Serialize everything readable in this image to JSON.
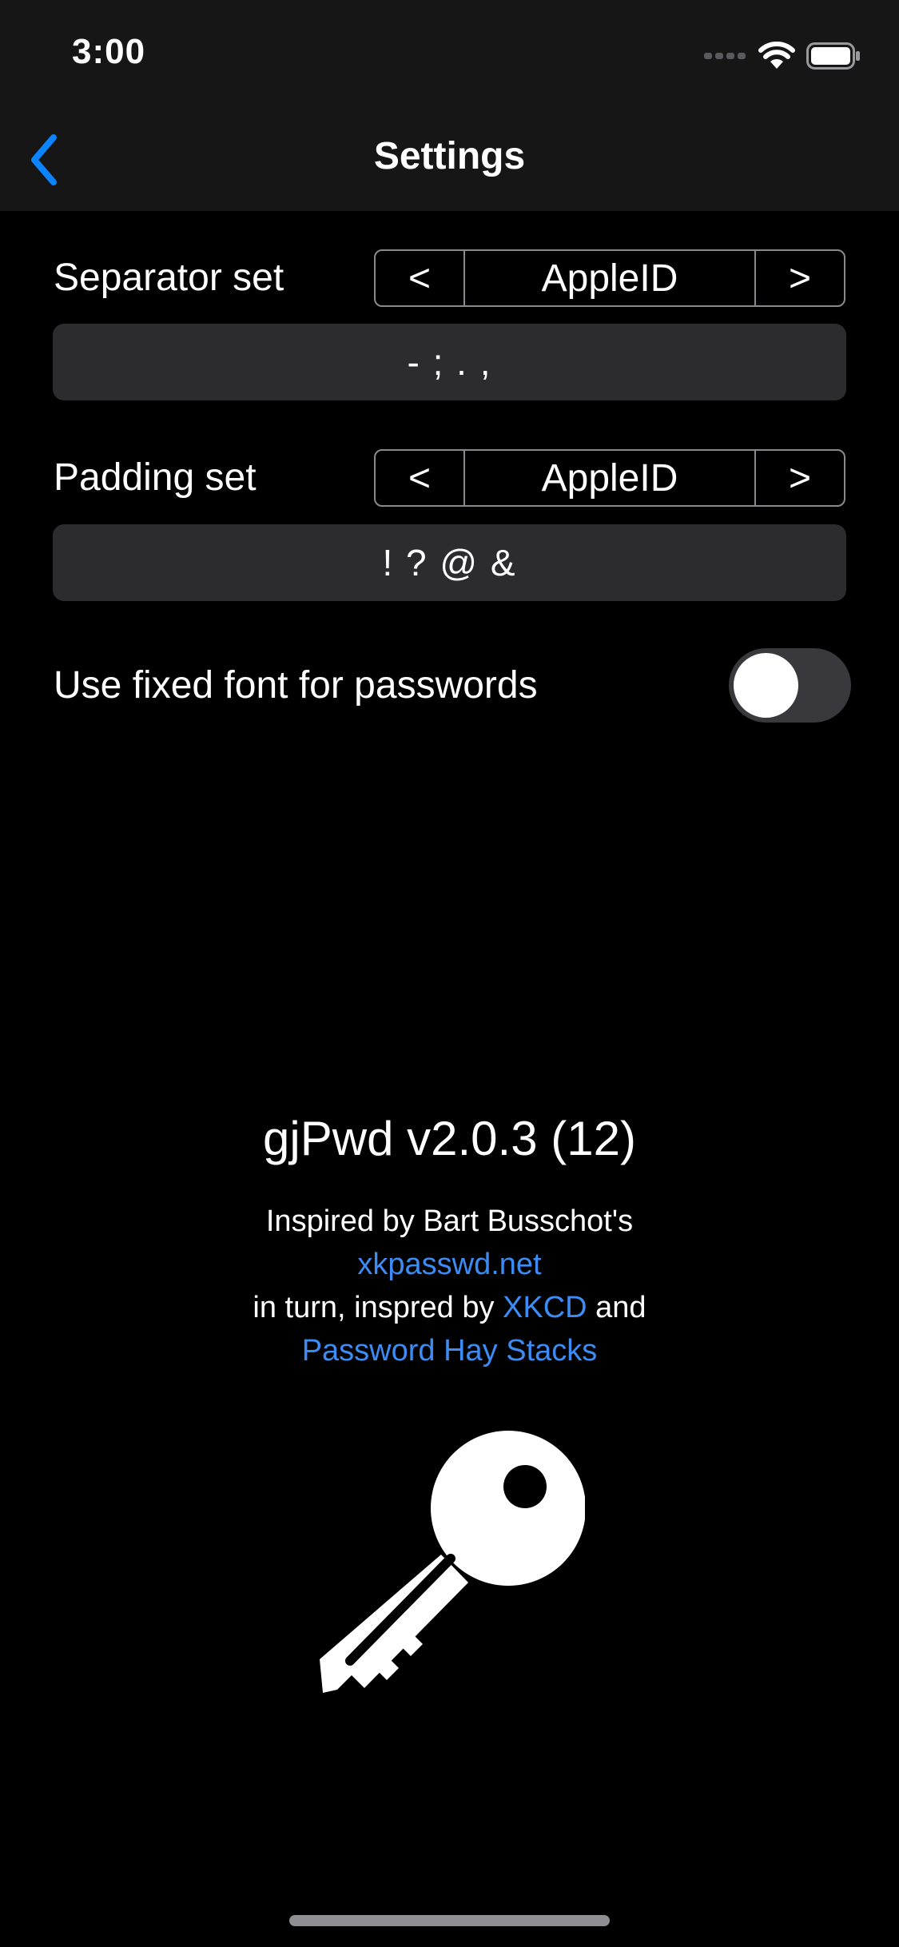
{
  "status_bar": {
    "time": "3:00"
  },
  "nav": {
    "title": "Settings",
    "back_icon": "chevron-left-icon",
    "accent": "#0a84ff"
  },
  "separator": {
    "label": "Separator set",
    "prev_label": "<",
    "value": "AppleID",
    "next_label": ">",
    "characters": "- ; . ,"
  },
  "padding": {
    "label": "Padding set",
    "prev_label": "<",
    "value": "AppleID",
    "next_label": ">",
    "characters": "! ? @ &"
  },
  "fixed_font": {
    "label": "Use fixed font for passwords",
    "on": false
  },
  "about": {
    "version": "gjPwd v2.0.3 (12)",
    "line1": "Inspired by Bart Busschot's",
    "link1": "xkpasswd.net",
    "line3_prefix": "in turn, inspred by ",
    "link2": "XKCD",
    "line3_suffix": " and",
    "link3": "Password Hay Stacks",
    "link_color": "#3d8cf5",
    "logo_icon": "key-icon"
  }
}
